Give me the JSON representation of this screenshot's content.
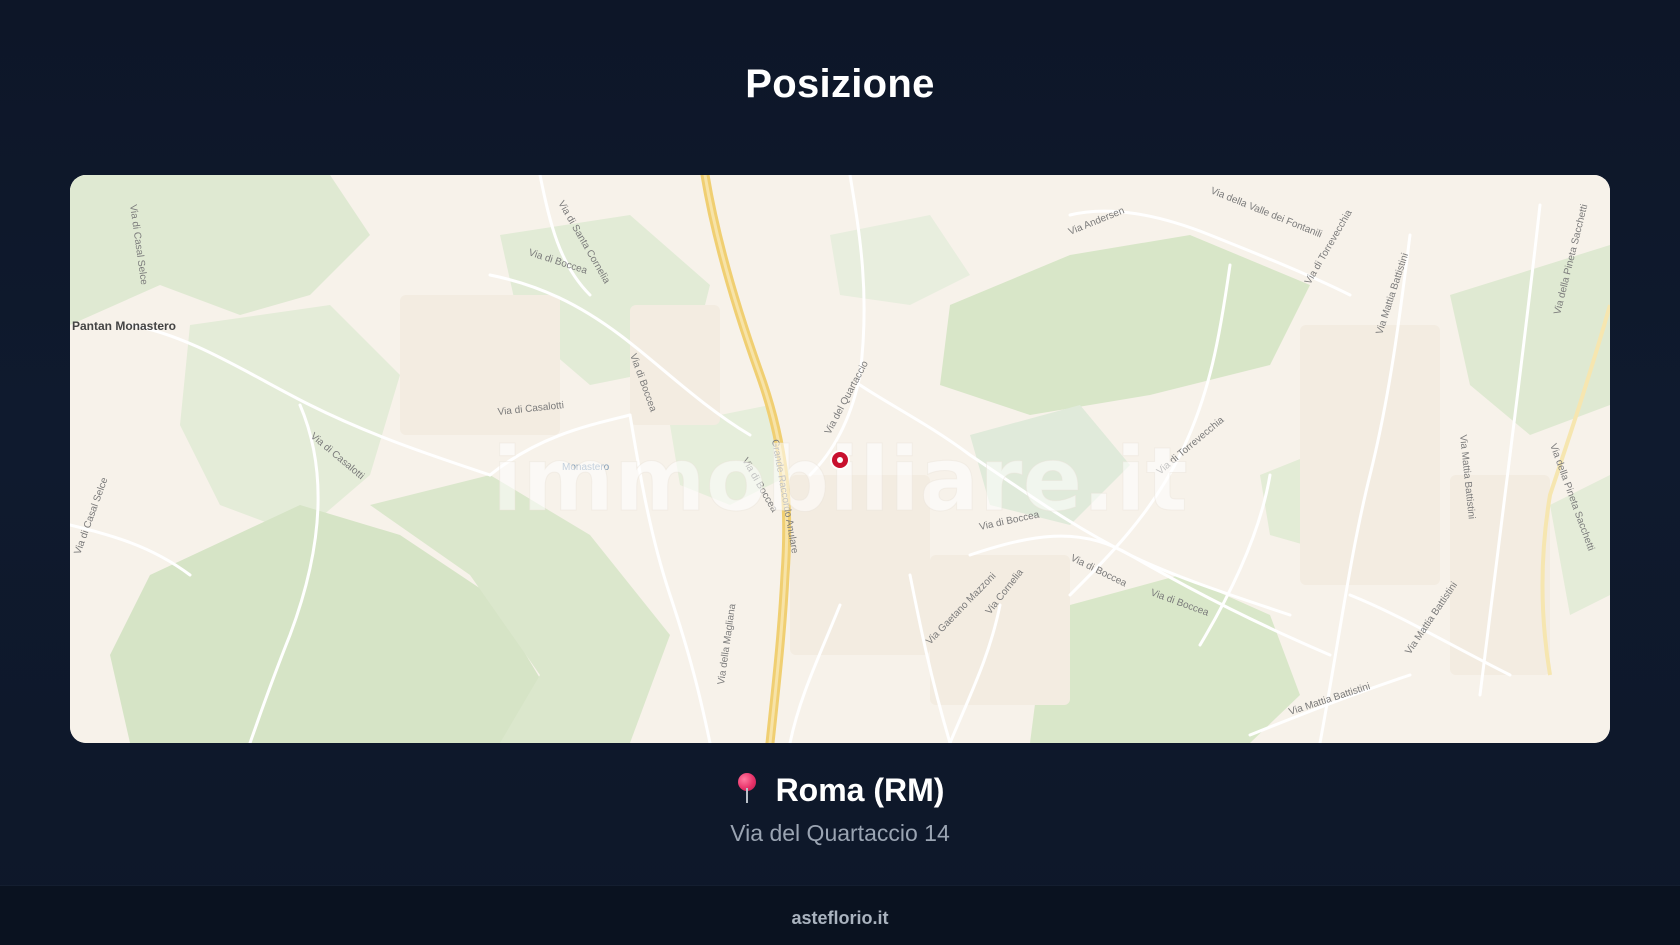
{
  "header": {
    "title": "Posizione"
  },
  "map": {
    "watermark": "immobiliare.it",
    "place_label": "Pantan Monastero",
    "marker_icon": "map-marker-icon",
    "street_labels": [
      "Via di Casal Selce",
      "Via di Boccea",
      "Via di Santa Cornelia",
      "Via di Boccea",
      "Via di Casalotti",
      "Via di Casalotti",
      "Monastero",
      "Via di Boccea",
      "Grande Raccordo Anulare",
      "Via della Magliana",
      "Via del Quartaccio",
      "Via Andersen",
      "Via della Valle dei Fontanili",
      "Via di Torrevecchia",
      "Via Mattia Battistini",
      "Via della Pineta Sacchetti",
      "Via di Torrevecchia",
      "Via di Boccea",
      "Via di Boccea",
      "Via di Boccea",
      "Via Gaetano Mazzoni",
      "Via Cornelia",
      "Via Mattia Battistini",
      "Via Mattia Battistini",
      "Via della Pineta Sacchetti",
      "Via di Casal Selce",
      "Via Mattia Battistini"
    ],
    "colors": {
      "background": "#f7f2ea",
      "park": "#dfe9d2",
      "park_dark": "#cfe0bf",
      "motorway": "#f3d27a",
      "marker": "#c8102e"
    }
  },
  "location": {
    "pin_icon": "round-pushpin-icon",
    "city": "Roma (RM)",
    "address": "Via del Quartaccio 14"
  },
  "footer": {
    "site": "asteflorio.it"
  }
}
